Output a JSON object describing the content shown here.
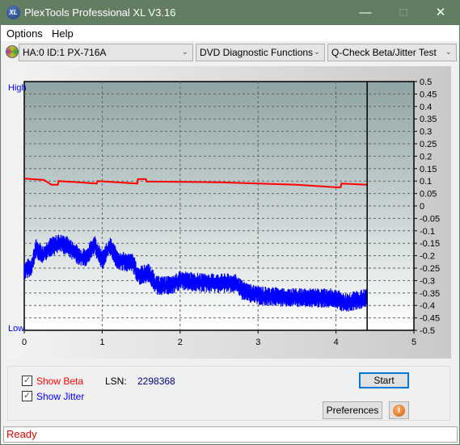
{
  "window": {
    "title": "PlexTools Professional XL V3.16",
    "logo_text": "XL"
  },
  "menu": [
    {
      "label": "Options"
    },
    {
      "label": "Help"
    }
  ],
  "toolbar": {
    "drive": "HA:0 ID:1  PX-716A",
    "function": "DVD Diagnostic Functions",
    "test": "Q-Check Beta/Jitter Test"
  },
  "chart_data": {
    "type": "line",
    "left_label_top": "High",
    "left_label_bottom": "Low",
    "xlim": [
      0,
      5
    ],
    "ylim": [
      -0.5,
      0.5
    ],
    "x_ticks": [
      "0",
      "1",
      "2",
      "3",
      "4",
      "5"
    ],
    "y_ticks": [
      "0.5",
      "0.45",
      "0.4",
      "0.35",
      "0.3",
      "0.25",
      "0.2",
      "0.15",
      "0.1",
      "0.05",
      "0",
      "-0.05",
      "-0.1",
      "-0.15",
      "-0.2",
      "-0.25",
      "-0.3",
      "-0.35",
      "-0.4",
      "-0.45",
      "-0.5"
    ],
    "grid": true,
    "marker_x": 4.4,
    "colors": {
      "beta": "#ff0000",
      "jitter": "#0000ff"
    },
    "series": [
      {
        "key": "beta",
        "points": [
          [
            0,
            0.11
          ],
          [
            0.25,
            0.105
          ],
          [
            0.35,
            0.085
          ],
          [
            0.43,
            0.085
          ],
          [
            0.44,
            0.1
          ],
          [
            0.7,
            0.095
          ],
          [
            0.93,
            0.09
          ],
          [
            0.94,
            0.1
          ],
          [
            1.45,
            0.09
          ],
          [
            1.46,
            0.108
          ],
          [
            1.56,
            0.108
          ],
          [
            1.57,
            0.098
          ],
          [
            2.5,
            0.095
          ],
          [
            3.0,
            0.09
          ],
          [
            3.5,
            0.085
          ],
          [
            4.0,
            0.075
          ],
          [
            4.06,
            0.075
          ],
          [
            4.07,
            0.09
          ],
          [
            4.4,
            0.085
          ]
        ]
      },
      {
        "key": "jitter",
        "points": [
          [
            0,
            -0.26
          ],
          [
            0.1,
            -0.24
          ],
          [
            0.15,
            -0.17
          ],
          [
            0.25,
            -0.2
          ],
          [
            0.3,
            -0.17
          ],
          [
            0.45,
            -0.15
          ],
          [
            0.55,
            -0.16
          ],
          [
            0.7,
            -0.2
          ],
          [
            0.8,
            -0.21
          ],
          [
            0.9,
            -0.15
          ],
          [
            0.95,
            -0.19
          ],
          [
            1.0,
            -0.22
          ],
          [
            1.1,
            -0.16
          ],
          [
            1.2,
            -0.22
          ],
          [
            1.4,
            -0.23
          ],
          [
            1.45,
            -0.28
          ],
          [
            1.6,
            -0.27
          ],
          [
            1.7,
            -0.32
          ],
          [
            1.9,
            -0.32
          ],
          [
            2.0,
            -0.3
          ],
          [
            2.3,
            -0.31
          ],
          [
            2.7,
            -0.31
          ],
          [
            2.8,
            -0.34
          ],
          [
            3.0,
            -0.36
          ],
          [
            3.5,
            -0.37
          ],
          [
            4.0,
            -0.37
          ],
          [
            4.1,
            -0.39
          ],
          [
            4.4,
            -0.37
          ]
        ]
      }
    ]
  },
  "controls": {
    "show_beta": "Show Beta",
    "show_jitter": "Show Jitter",
    "show_beta_checked": true,
    "show_jitter_checked": true,
    "lsn_label": "LSN:",
    "lsn_value": "2298368",
    "start": "Start",
    "preferences": "Preferences"
  },
  "status": "Ready"
}
